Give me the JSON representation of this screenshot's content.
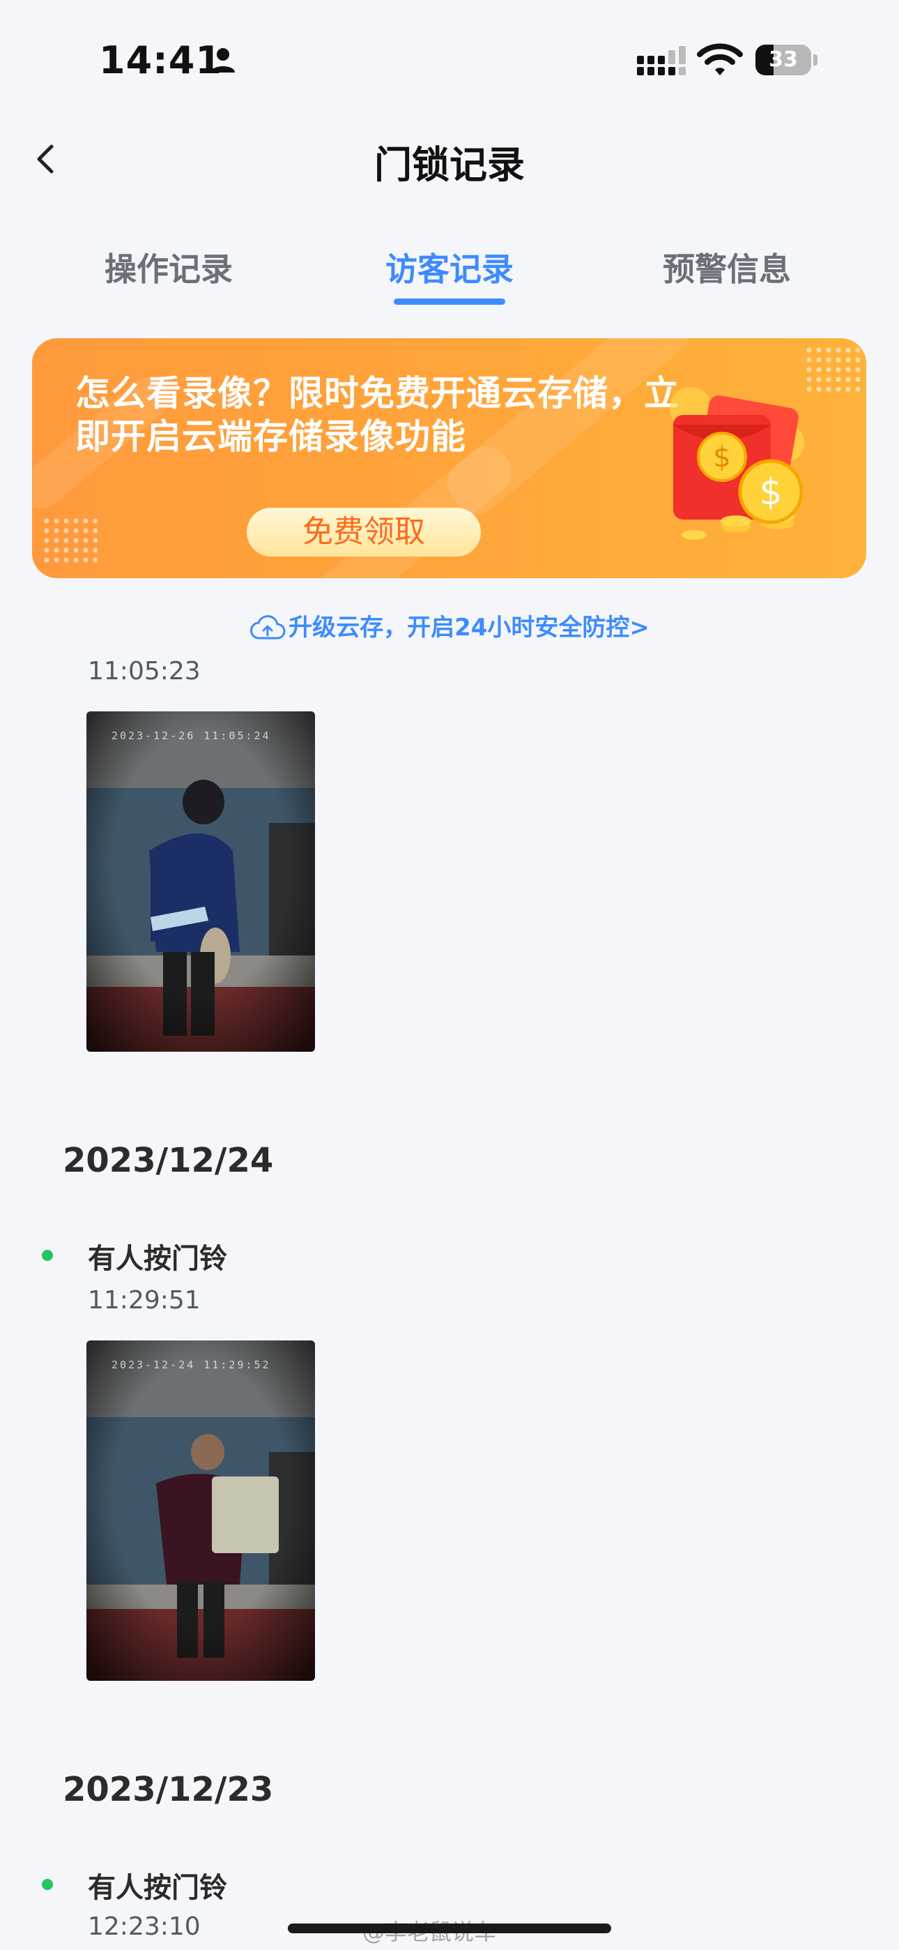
{
  "status_bar": {
    "time": "14:41",
    "battery_level": "33",
    "battery_fraction": 0.33,
    "icons": [
      "person-icon",
      "signal-icon",
      "wifi-icon",
      "battery-icon"
    ]
  },
  "header": {
    "title": "门锁记录",
    "back_icon": "chevron-left-icon"
  },
  "tabs": [
    {
      "label": "操作记录",
      "active": false
    },
    {
      "label": "访客记录",
      "active": true
    },
    {
      "label": "预警信息",
      "active": false
    }
  ],
  "colors": {
    "accent": "#3d8bff",
    "banner_orange": "#ffa23a",
    "status_green": "#22c55e",
    "background": "#f4f6f9"
  },
  "banner": {
    "text": "怎么看录像？限时免费开通云存储，立即开启云端存储录像功能",
    "button_label": "免费领取"
  },
  "cloud_link": {
    "text": "升级云存，开启24小时安全防控>",
    "icon": "cloud-upload-icon"
  },
  "records": {
    "first": {
      "time": "11:05:23",
      "snapshot_stamp": "2023-12-26 11:05:24"
    },
    "groups": [
      {
        "date": "2023/12/24",
        "event": "有人按门铃",
        "time": "11:29:51",
        "snapshot_stamp": "2023-12-24 11:29:52"
      },
      {
        "date": "2023/12/23",
        "event": "有人按门铃",
        "time": "12:23:10"
      }
    ]
  },
  "watermark": "@李老鼠说车"
}
